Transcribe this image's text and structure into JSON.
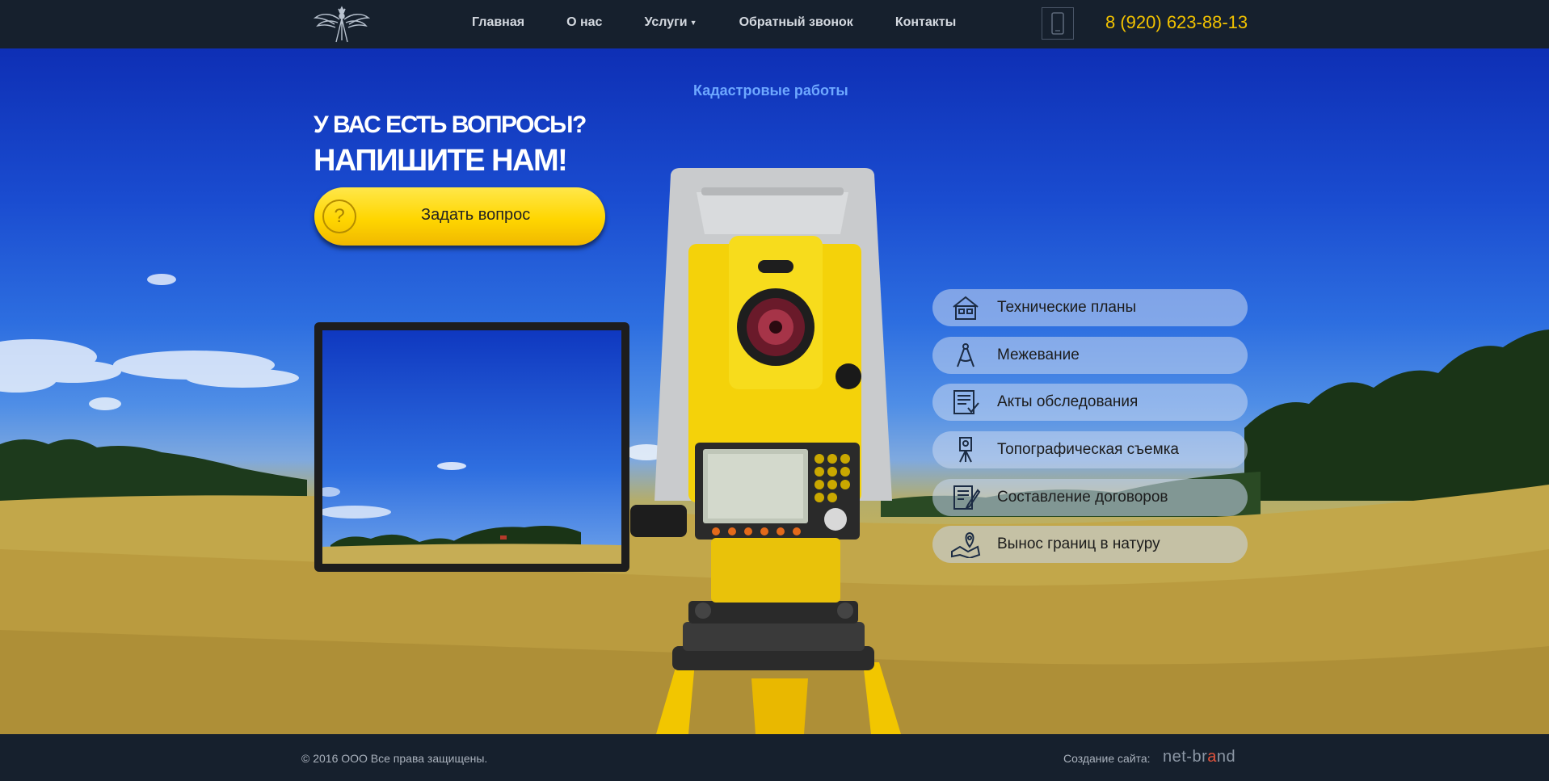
{
  "header": {
    "nav": [
      {
        "label": "Главная"
      },
      {
        "label": "О нас"
      },
      {
        "label": "Услуги"
      },
      {
        "label": "Обратный звонок"
      },
      {
        "label": "Контакты"
      }
    ],
    "phone": "8 (920) 623-88-13"
  },
  "hero": {
    "title": "Кадастровые работы",
    "question_line1": "У ВАС ЕСТЬ ВОПРОСЫ?",
    "question_line2": "НАПИШИТЕ НАМ!",
    "ask_button": "Задать вопрос",
    "ask_icon": "?",
    "services": [
      {
        "label": "Технические планы",
        "icon": "house-plan-icon"
      },
      {
        "label": "Межевание",
        "icon": "compass-icon"
      },
      {
        "label": "Акты обследования",
        "icon": "document-check-icon"
      },
      {
        "label": "Топографическая съемка",
        "icon": "theodolite-icon"
      },
      {
        "label": "Составление договоров",
        "icon": "contract-pen-icon"
      },
      {
        "label": "Вынос границ в натуру",
        "icon": "map-pin-icon"
      }
    ]
  },
  "footer": {
    "copyright": "© 2016 ООО Все права защищены.",
    "made_by": "Создание сайта:",
    "brand_part1": "net-br",
    "brand_part2": "a",
    "brand_part3": "nd"
  },
  "colors": {
    "header_bg": "#16202d",
    "phone": "#f2c200",
    "accent_yellow": "#ffd600",
    "title_blue": "#6ea8ff"
  }
}
